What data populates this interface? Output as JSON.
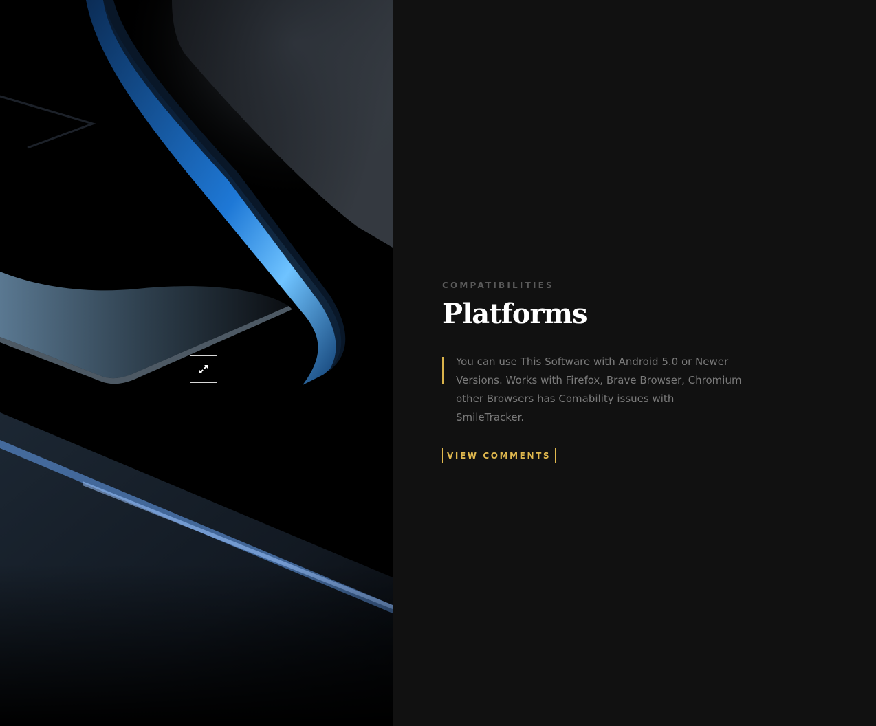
{
  "section": {
    "eyebrow": "COMPATIBILITIES",
    "title": "Platforms",
    "description": "You can use This Software with Android 5.0 or Newer Versions. Works with Firefox, Brave Browser, Chromium other Browsers has Comability issues with SmileTracker.",
    "cta_label": "VIEW COMMENTS"
  },
  "hero": {
    "expand_icon": "expand-icon"
  },
  "colors": {
    "accent": "#e0b84e",
    "background": "#111111",
    "hero_background": "#000000",
    "heading": "#ffffff",
    "body_text": "#7a7a7a",
    "eyebrow": "#5a5a5a"
  }
}
